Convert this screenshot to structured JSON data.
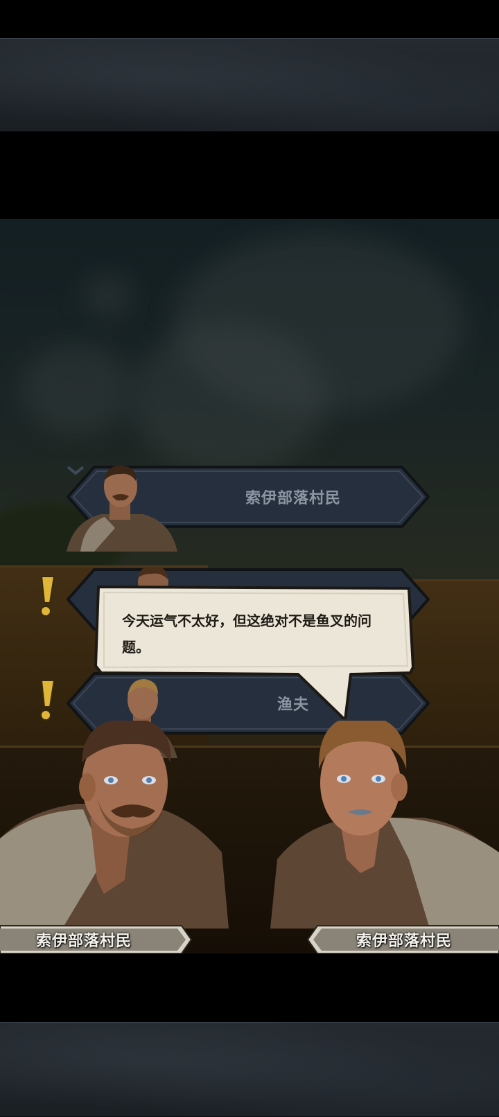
{
  "dialogue": {
    "text": "今天运气不太好，但这绝对不是鱼叉的问题。"
  },
  "npc_list": [
    {
      "name": "索伊部落村民",
      "has_alert": false
    },
    {
      "name": "",
      "has_alert": true
    },
    {
      "name": "渔夫",
      "has_alert": true
    }
  ],
  "speakers": {
    "left": "索伊部落村民",
    "right": "索伊部落村民"
  },
  "colors": {
    "nameplate_bg": "#262f3d",
    "alert": "#e0b53a",
    "bubble": "#ece6d8",
    "tag": "#d8d4c8"
  },
  "icons": [
    "alert-exclamation-icon",
    "chevron-down-icon"
  ]
}
